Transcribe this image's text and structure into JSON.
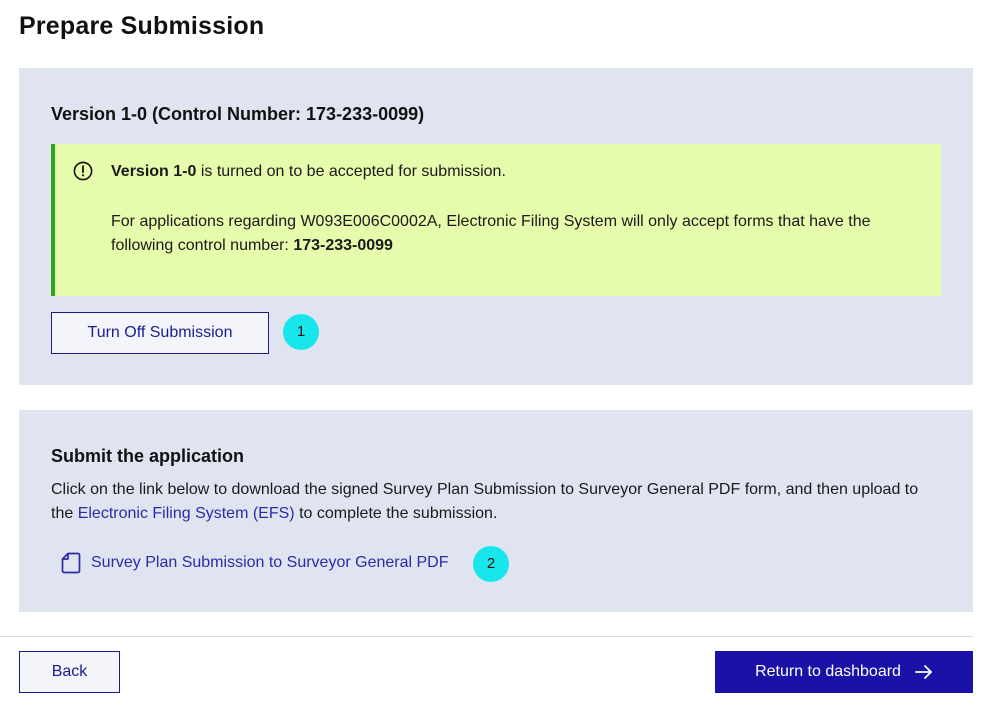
{
  "page": {
    "title": "Prepare Submission"
  },
  "version_panel": {
    "heading": "Version 1-0 (Control Number: 173-233-0099)",
    "notice": {
      "icon": "alert-circle-icon",
      "version_label": "Version 1-0",
      "line1_rest": " is turned on to be accepted for submission.",
      "line2_text": "For applications regarding W093E006C0002A, Electronic Filing System will only accept forms that have the following control number: ",
      "control_number": "173-233-0099"
    },
    "turn_off_button": "Turn Off Submission",
    "marker": "1"
  },
  "submit_panel": {
    "heading": "Submit the application",
    "desc_part1": "Click on the link below to download the signed Survey Plan Submission to Surveyor General PDF form, and then upload to the ",
    "efs_link": "Electronic Filing System (EFS)",
    "desc_part2": " to complete the submission.",
    "pdf_link": "Survey Plan Submission to Surveyor General PDF",
    "pdf_icon": "document-icon",
    "marker": "2"
  },
  "footer": {
    "back_button": "Back",
    "return_button": "Return to dashboard",
    "return_icon": "arrow-right-icon"
  },
  "colors": {
    "panel_bg": "#dfe4f0",
    "notice_bg": "#e6fbab",
    "notice_border": "#2fa61b",
    "primary": "#1a11a6",
    "link": "#2b2ba8",
    "marker": "#17e6ea"
  }
}
